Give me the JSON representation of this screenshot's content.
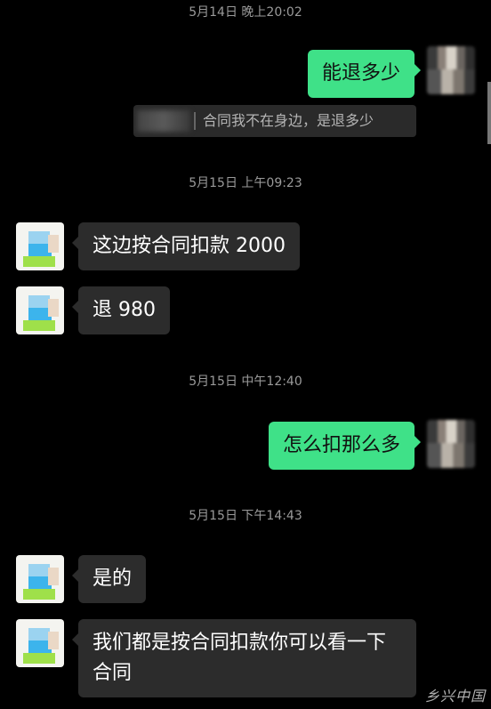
{
  "timestamps": [
    "5月14日 晚上20:02",
    "5月15日 上午09:23",
    "5月15日 中午12:40",
    "5月15日 下午14:43"
  ],
  "messages": {
    "m1": "能退多少",
    "quote": "合同我不在身边，是退多少",
    "m2": "这边按合同扣款 2000",
    "m3": "退 980",
    "m4": "怎么扣那么多",
    "m5": "是的",
    "m6": "我们都是按合同扣款你可以看一下合同"
  },
  "watermark": "乡兴中国",
  "colors": {
    "sent_bubble": "#3fe188",
    "received_bubble": "#2c2c2c",
    "background": "#000000"
  }
}
